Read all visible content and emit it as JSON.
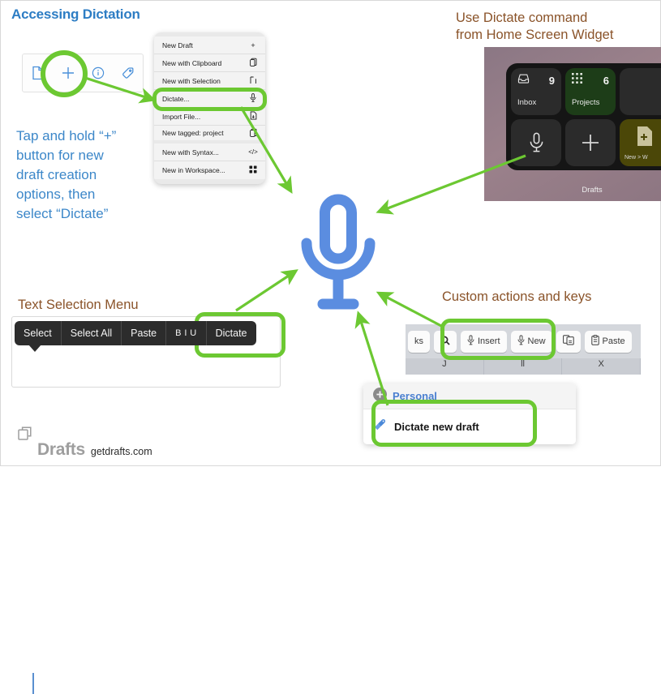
{
  "page": {
    "footer_brand": "Drafts",
    "footer_url": "getdrafts.com"
  },
  "sections": {
    "accessing": {
      "title": "Accessing Dictation",
      "instruction": "Tap and hold “+”\nbutton for new\ndraft creation\noptions, then\nselect “Dictate”"
    },
    "widget": {
      "heading": "Use Dictate command\nfrom Home Screen Widget",
      "app_label": "Drafts",
      "tiles": [
        {
          "name": "Inbox",
          "count": "9",
          "icon": "inbox-icon",
          "color": "#2b2b2b"
        },
        {
          "name": "Projects",
          "count": "6",
          "icon": "grid-icon",
          "color": "#1d3d18"
        },
        {
          "name": "",
          "count": "",
          "icon": "blank-icon",
          "color": "#2b2b2b"
        },
        {
          "name": "",
          "count": "",
          "icon": "microphone-icon",
          "color": "#2b2b2b"
        },
        {
          "name": "",
          "count": "",
          "icon": "plus-icon",
          "color": "#2b2b2b"
        },
        {
          "name": "New > W",
          "count": "",
          "icon": "new-document-icon",
          "color": "#4b4708"
        }
      ]
    },
    "text_selection": {
      "heading": "Text Selection Menu",
      "menu_items": [
        {
          "label": "Select",
          "name": "select"
        },
        {
          "label": "Select All",
          "name": "select-all"
        },
        {
          "label": "Paste",
          "name": "paste"
        },
        {
          "label": "B I U",
          "name": "format"
        },
        {
          "label": "Dictate",
          "name": "dictate"
        }
      ]
    },
    "custom_actions": {
      "heading": "Custom actions and keys",
      "keyboard_keys": [
        {
          "label": "ks",
          "icon": "",
          "name": "tasks-key"
        },
        {
          "label": "",
          "icon": "search-icon",
          "name": "search-key"
        },
        {
          "label": "Insert",
          "icon": "microphone-icon",
          "name": "insert-key"
        },
        {
          "label": "New",
          "icon": "microphone-icon",
          "name": "new-key"
        },
        {
          "label": "",
          "icon": "copy-icon",
          "name": "copy-key"
        },
        {
          "label": "Paste",
          "icon": "clipboard-icon",
          "name": "paste-key"
        },
        {
          "label": "",
          "icon": "chevron-down-icon",
          "name": "collapse-key"
        }
      ],
      "keyboard_row2": [
        "J",
        "ll",
        "X"
      ],
      "popup": {
        "group": "Personal",
        "item": "Dictate new draft"
      }
    }
  },
  "new_draft_toolbar": {
    "icons": [
      {
        "name": "document-icon"
      },
      {
        "name": "plus-icon"
      },
      {
        "name": "info-icon"
      },
      {
        "name": "tag-icon"
      }
    ]
  },
  "context_menu": {
    "items": [
      {
        "label": "New Draft",
        "icon": "plus-icon",
        "gap": false
      },
      {
        "label": "New with Clipboard",
        "icon": "clipboard-icon",
        "gap": false
      },
      {
        "label": "New with Selection",
        "icon": "selection-icon",
        "gap": false
      },
      {
        "label": "Dictate...",
        "icon": "microphone-icon",
        "gap": false
      },
      {
        "label": "Import File...",
        "icon": "file-import-icon",
        "gap": false
      },
      {
        "label": "New tagged: project",
        "icon": "clipboard-icon",
        "gap": true
      },
      {
        "label": "New with Syntax...",
        "icon": "code-icon",
        "gap": false
      },
      {
        "label": "New in Workspace...",
        "icon": "workspace-icon",
        "gap": false
      }
    ]
  },
  "colors": {
    "accent_blue": "#2d7dc4",
    "body_blue": "#3c87c9",
    "heading_brown": "#8a5329",
    "highlight_green": "#6cc832",
    "mic_blue": "#5b8de0"
  }
}
